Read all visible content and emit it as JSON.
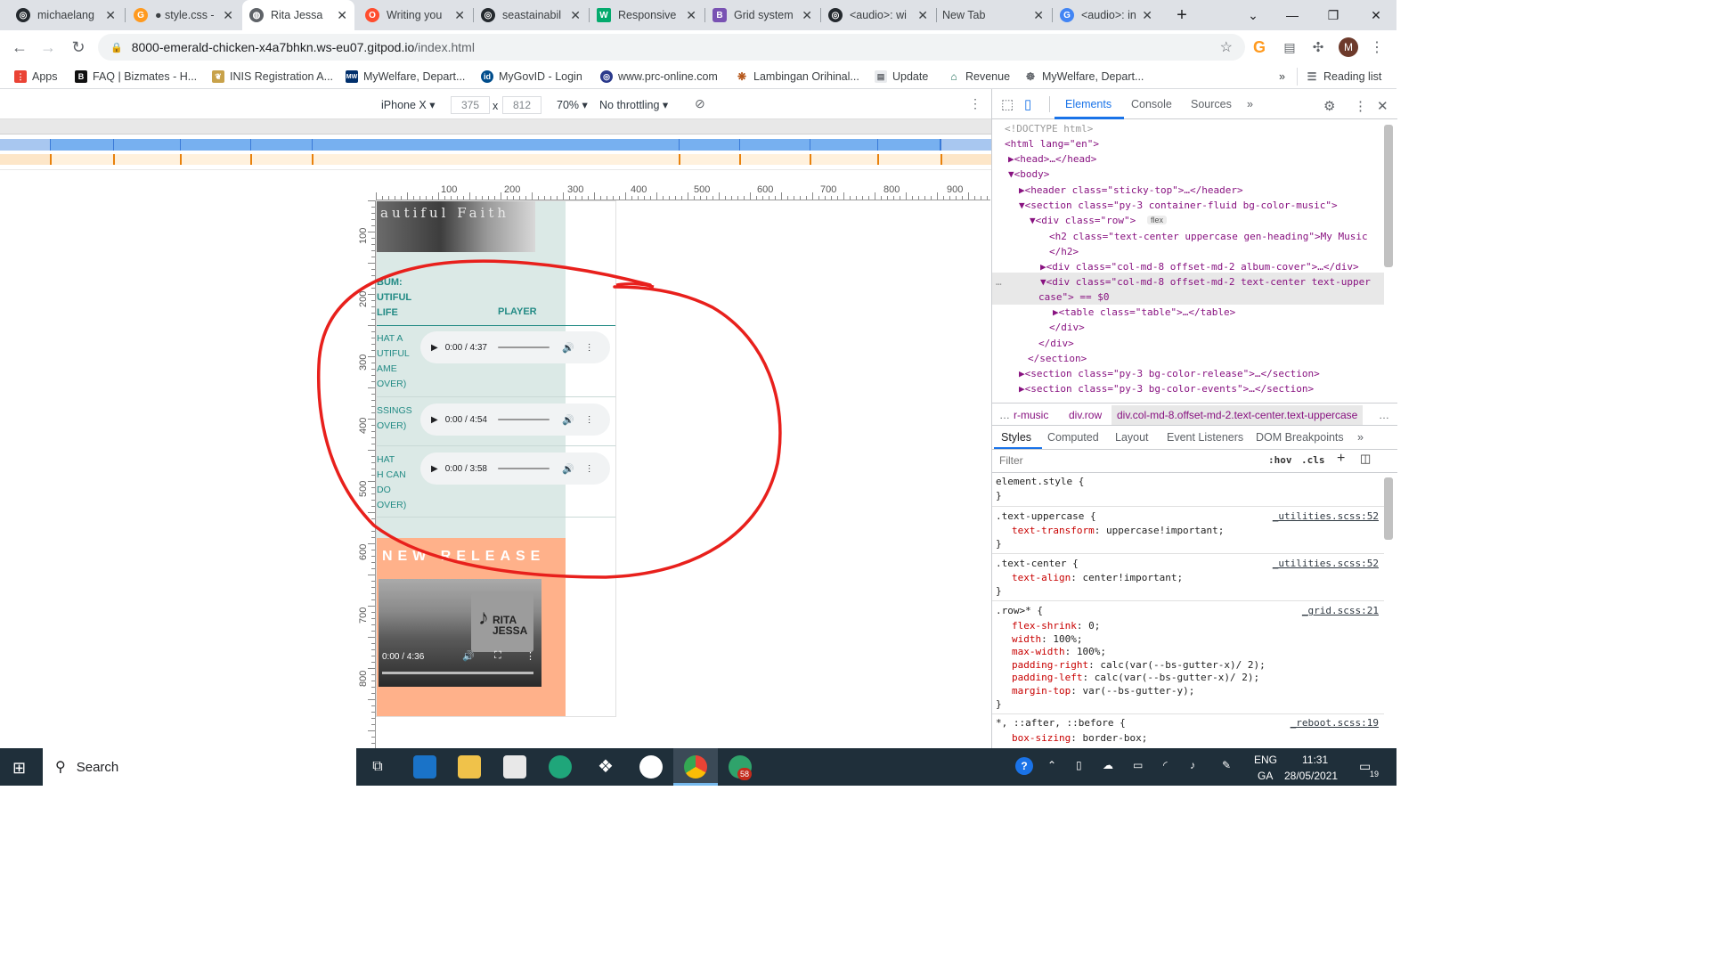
{
  "browser": {
    "tabs": [
      {
        "title": "michaelang",
        "favicon": "github-icon"
      },
      {
        "title": "● style.css -",
        "favicon": "gitpod-icon"
      },
      {
        "title": "Rita Jessa",
        "favicon": "globe-icon"
      },
      {
        "title": "Writing you",
        "favicon": "opera-icon"
      },
      {
        "title": "seastainabil",
        "favicon": "github-icon"
      },
      {
        "title": "Responsive",
        "favicon": "w3schools-icon"
      },
      {
        "title": "Grid system",
        "favicon": "bootstrap-icon"
      },
      {
        "title": "<audio>: wi",
        "favicon": "github-icon"
      },
      {
        "title": "New Tab",
        "favicon": ""
      },
      {
        "title": "<audio>: in",
        "favicon": "google-icon"
      }
    ],
    "new_tab": "+",
    "url_host": "8000-emerald-chicken-x4a7bhkn.ws-eu07.gitpod.io",
    "url_path": "/index.html",
    "profile_initial": "M",
    "bookmarks": [
      "Apps",
      "FAQ | Bizmates - H...",
      "INIS Registration A...",
      "MyWelfare, Depart...",
      "MyGovID - Login",
      "www.prc-online.com",
      "Lambingan Orihinal...",
      "Update",
      "Revenue",
      "MyWelfare, Depart..."
    ],
    "bookmarks_more": "»",
    "reading_list": "Reading list"
  },
  "device_toolbar": {
    "device": "iPhone X",
    "width": "375",
    "times": "x",
    "height": "812",
    "zoom": "70%",
    "throttle": "No throttling"
  },
  "rulers": {
    "h": [
      "100",
      "200",
      "300",
      "400",
      "500",
      "600",
      "700",
      "800",
      "900"
    ],
    "v": [
      "100",
      "200",
      "300",
      "400",
      "500",
      "600",
      "700",
      "800"
    ]
  },
  "page": {
    "header_image_text": "autiful Faith",
    "album_col": [
      "BUM:",
      "UTIFUL",
      "LIFE"
    ],
    "player_heading": "PLAYER",
    "songs": [
      {
        "lines": [
          "HAT A",
          "UTIFUL",
          "AME",
          "OVER)"
        ],
        "time": "0:00 / 4:37"
      },
      {
        "lines": [
          "SSINGS",
          "OVER)"
        ],
        "time": "0:00 / 4:54"
      },
      {
        "lines": [
          "HAT",
          "H CAN",
          "DO",
          "OVER)"
        ],
        "time": "0:00 / 3:58"
      }
    ],
    "new_release": "NEW RELEASE",
    "logo_text_1": "RITA",
    "logo_text_2": "JESSA",
    "video_time": "0:00 / 4:36"
  },
  "devtools": {
    "tabs": [
      "Elements",
      "Console",
      "Sources",
      "»"
    ],
    "dom": [
      "<!DOCTYPE html>",
      "<html lang=\"en\">",
      "▶<head>…</head>",
      "▼<body>",
      "▶<header class=\"sticky-top\">…</header>",
      "▼<section class=\"py-3 container-fluid bg-color-music\">",
      "▼<div class=\"row\">",
      "<h2 class=\"text-center uppercase gen-heading\">My Music",
      "</h2>",
      "▶<div class=\"col-md-8 offset-md-2 album-cover\">…</div>",
      "▼<div class=\"col-md-8 offset-md-2 text-center text-upper",
      "case\"> == $0",
      "▶<table class=\"table\">…</table>",
      "</div>",
      "</div>",
      "</section>",
      "▶<section class=\"py-3 bg-color-release\">…</section>",
      "▶<section class=\"py-3  bg-color-events\">…</section>"
    ],
    "flex_badge": "flex",
    "breadcrumbs": [
      "…",
      "r-music",
      "div.row",
      "div.col-md-8.offset-md-2.text-center.text-uppercase",
      "…"
    ],
    "style_tabs": [
      "Styles",
      "Computed",
      "Layout",
      "Event Listeners",
      "DOM Breakpoints",
      "»"
    ],
    "filter_placeholder": "Filter",
    "hov": ":hov",
    "cls": ".cls",
    "rules": [
      {
        "selector": "element.style {",
        "source": "",
        "props": []
      },
      {
        "selector": ".text-uppercase {",
        "source": "_utilities.scss:52",
        "props": [
          [
            "text-transform",
            "uppercase!important;"
          ]
        ]
      },
      {
        "selector": ".text-center {",
        "source": "_utilities.scss:52",
        "props": [
          [
            "text-align",
            "center!important;"
          ]
        ]
      },
      {
        "selector": ".row>* {",
        "source": "_grid.scss:21",
        "props": [
          [
            "flex-shrink",
            "0;"
          ],
          [
            "width",
            "100%;"
          ],
          [
            "max-width",
            "100%;"
          ],
          [
            "padding-right",
            "calc(var(--bs-gutter-x)/ 2);"
          ],
          [
            "padding-left",
            "calc(var(--bs-gutter-x)/ 2);"
          ],
          [
            "margin-top",
            "var(--bs-gutter-y);"
          ]
        ]
      },
      {
        "selector": "*, ::after, ::before {",
        "source": "_reboot.scss:19",
        "props": [
          [
            "box-sizing",
            "border-box;"
          ]
        ]
      }
    ]
  },
  "taskbar": {
    "search": "Search",
    "lang_1": "ENG",
    "lang_2": "GA",
    "time": "11:31",
    "date": "28/05/2021",
    "notif_badge": "58",
    "action_count": "19"
  }
}
